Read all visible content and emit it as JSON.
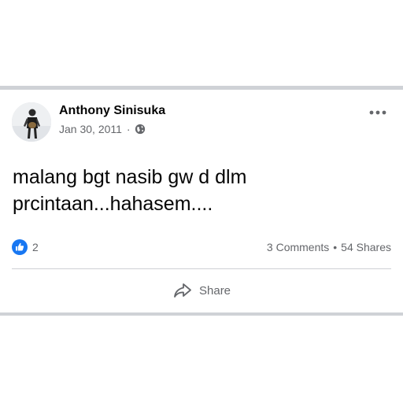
{
  "post": {
    "author": "Anthony Sinisuka",
    "date": "Jan 30, 2011",
    "dot": "·",
    "privacy_icon": "globe-icon",
    "menu_icon": "more-options-icon",
    "message": "malang bgt nasib gw d dlm prcintaan...hahasem....",
    "reactions": {
      "icon": "like-icon",
      "count": "2"
    },
    "stats": {
      "comments": "3 Comments",
      "separator": "•",
      "shares": "54 Shares"
    },
    "actions": {
      "share_label": "Share",
      "share_icon": "share-icon"
    }
  },
  "colors": {
    "like_blue": "#1877f2",
    "secondary_text": "#65676b",
    "divider": "#cfd2d6"
  }
}
